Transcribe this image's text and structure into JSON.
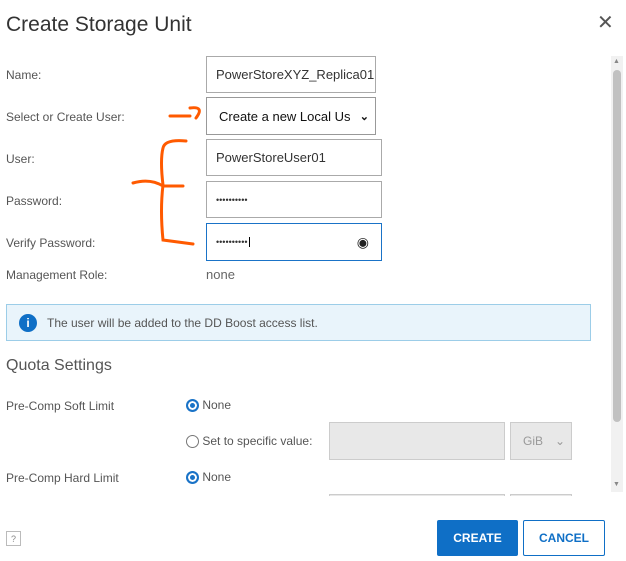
{
  "dialog": {
    "title": "Create Storage Unit",
    "close_icon": "close-icon"
  },
  "form": {
    "name_label": "Name:",
    "name_value": "PowerStoreXYZ_Replica01",
    "user_select_label": "Select or Create User:",
    "user_select_value": "Create a new Local Us",
    "user_label": "User:",
    "user_value": "PowerStoreUser01",
    "password_label": "Password:",
    "password_value": "••••••••••",
    "verify_label": "Verify Password:",
    "verify_value": "••••••••••",
    "role_label": "Management Role:",
    "role_value": "none"
  },
  "info": {
    "text": "The user will be added to the DD Boost access list.",
    "icon": "i"
  },
  "quota": {
    "heading": "Quota Settings",
    "soft_label": "Pre-Comp Soft Limit",
    "soft_none": "None",
    "soft_specific": "Set to specific value:",
    "soft_unit": "GiB",
    "hard_label": "Pre-Comp Hard Limit",
    "hard_none": "None"
  },
  "footer": {
    "help": "?",
    "create": "CREATE",
    "cancel": "CANCEL"
  },
  "colors": {
    "accent": "#0f6fc6",
    "annotation": "#ff5a00"
  }
}
